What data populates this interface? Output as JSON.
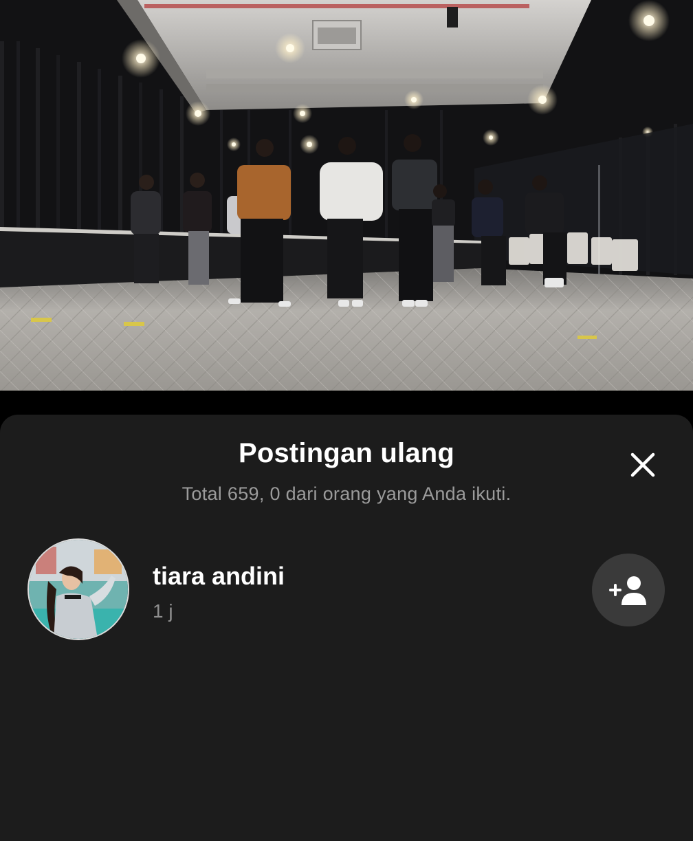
{
  "video": {
    "description_icon": "dance-practice-video"
  },
  "repost_sheet": {
    "title": "Postingan ulang",
    "subtitle": "Total 659, 0 dari orang yang Anda ikuti.",
    "close_icon": "close-icon",
    "users": [
      {
        "name": "tiara andini",
        "time": "1 j",
        "follow_icon": "add-user-icon"
      }
    ]
  },
  "colors": {
    "sheet_bg": "#1c1c1c",
    "title_text": "#ffffff",
    "subtitle_text": "#9b9b9b",
    "follow_button_bg": "#3a3a3a"
  }
}
